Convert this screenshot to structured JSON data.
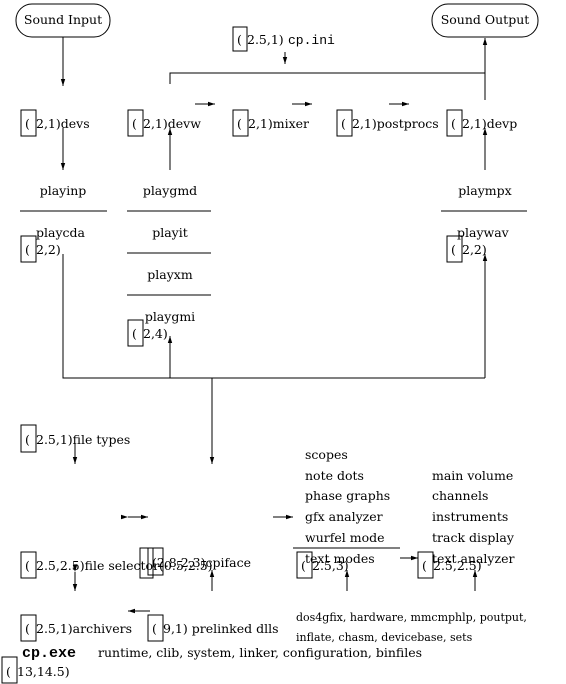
{
  "nodes": {
    "sound_input": "Sound Input",
    "sound_output": "Sound Output",
    "cpini_coord": "2.5,1)",
    "cpini_name": "cp.ini",
    "devs": "2,1)devs",
    "devw": "2,1)devw",
    "mixer": "2,1)mixer",
    "postprocs": "2,1)postprocs",
    "devp": "2,1)devp",
    "playinp": "playinp",
    "playcda": "playcda",
    "left_coord": "2,2)",
    "playgmd": "playgmd",
    "playit": "playit",
    "playxm": "playxm",
    "playgmi": "playgmi",
    "mid_coord": "2,4)",
    "plaympx": "plaympx",
    "playwav": "playwav",
    "right_coord": "2,2)",
    "file_types": "2.5,1)file types",
    "file_selector": "2.5,2.5)file selector(0.5,2.5)",
    "cpiface": "(2.8,2.3)cpiface",
    "gfx_coord": "2.5,3)",
    "text_coord": "2.5,2.5)",
    "archivers": "2.5,1)archivers",
    "prelinked": "9,1) prelinked dlls",
    "prelinked_list_1": "dos4gfix, hardware, mmcmphlp, poutput,",
    "prelinked_list_2": "inflate, chasm, devicebase, sets",
    "cpexe": "cp.exe",
    "cpexe_list": "runtime, clib, system, linker, configuration, binfiles",
    "bottom_coord": "13,14.5)",
    "paren": "("
  },
  "gfx_modes": [
    "scopes",
    "note dots",
    "phase graphs",
    "gfx analyzer",
    "wurfel mode",
    "text modes"
  ],
  "text_modes": [
    "main volume",
    "channels",
    "instruments",
    "track display",
    "text analyzer"
  ]
}
